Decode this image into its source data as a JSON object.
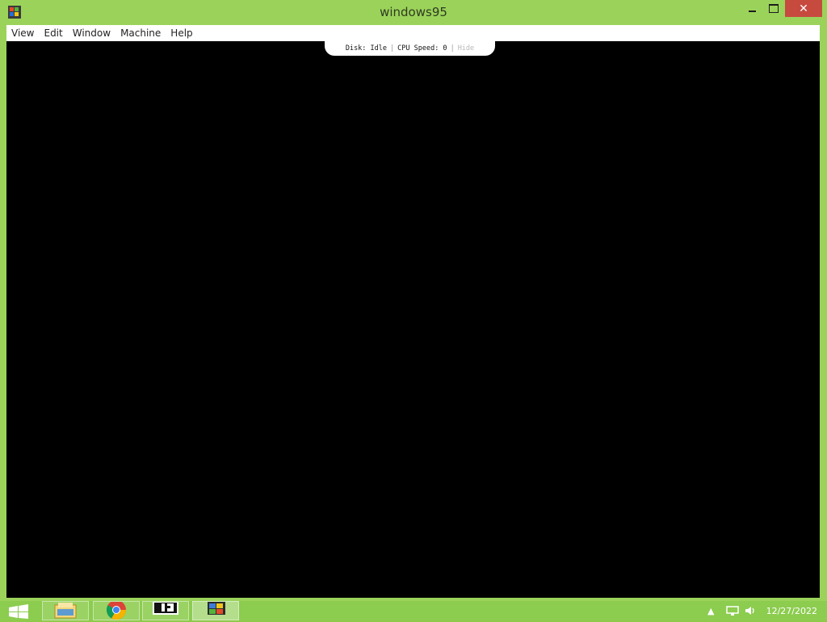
{
  "window": {
    "title": "windows95",
    "minimize_icon": "minimize-icon",
    "maximize_icon": "maximize-icon",
    "close_icon": "close-icon",
    "close_symbol": "✕"
  },
  "menu": {
    "items": [
      "View",
      "Edit",
      "Window",
      "Machine",
      "Help"
    ]
  },
  "status": {
    "disk_label": "Disk: Idle",
    "separator": "|",
    "cpu_label": "CPU Speed: 0",
    "hide_label": "Hide"
  },
  "taskbar": {
    "start_icon": "windows-start-icon",
    "apps": [
      "file-explorer-icon",
      "chrome-icon",
      "terminal-icon",
      "windows95-app-icon"
    ],
    "tray_icons": [
      "show-hidden-icons-chevron",
      "network-icon",
      "volume-icon"
    ],
    "clock": "12/27/2022"
  },
  "colors": {
    "frame": "#9bd35a",
    "close_button": "#c74a3f",
    "screen": "#000000"
  }
}
